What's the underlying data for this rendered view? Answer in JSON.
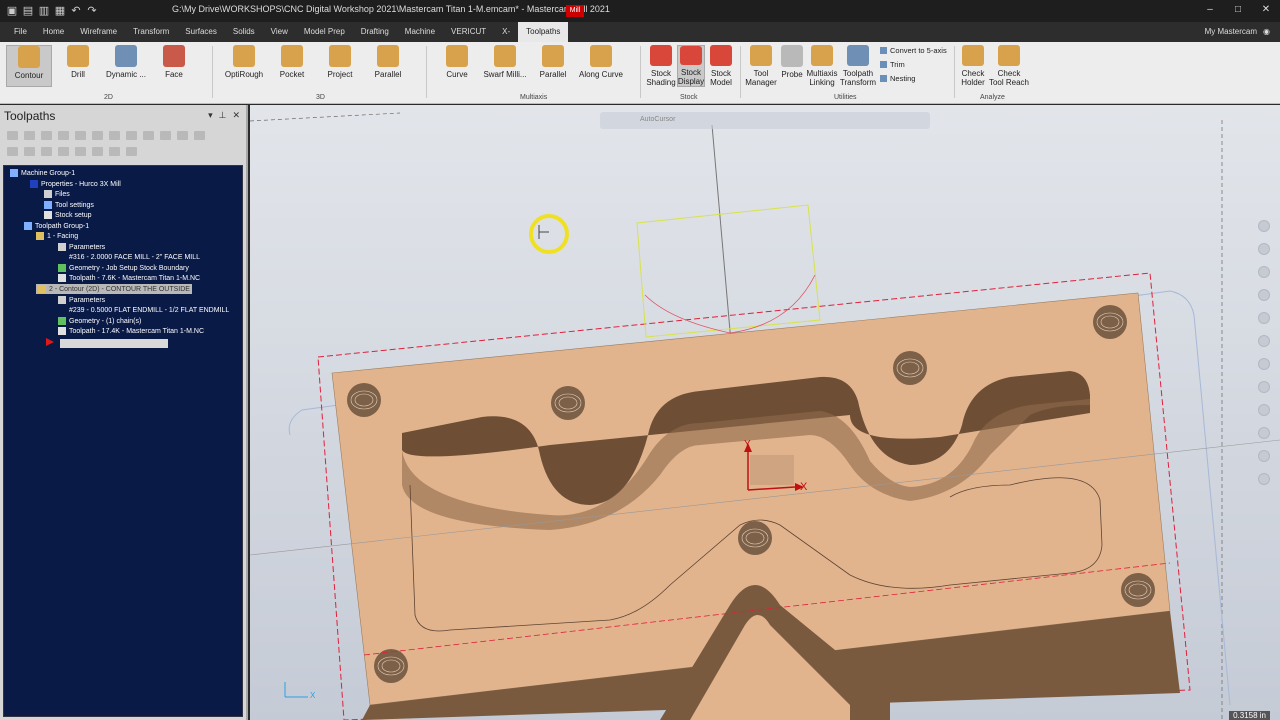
{
  "titlebar": {
    "title": "G:\\My Drive\\WORKSHOPS\\CNC Digital Workshop 2021\\Mastercam Titan 1-M.emcam* - Mastercam Mill 2021",
    "badge": "Mill",
    "controls": [
      "–",
      "□",
      "✕"
    ]
  },
  "menu": {
    "items": [
      "File",
      "Home",
      "Wireframe",
      "Transform",
      "Surfaces",
      "Solids",
      "View",
      "Model Prep",
      "Drafting",
      "Machine",
      "VERICUT",
      "X-",
      "Toolpaths"
    ],
    "active_index": 12,
    "right": "My Mastercam"
  },
  "ribbon": {
    "buttons_2d": [
      "Contour",
      "Drill",
      "Dynamic ...",
      "Face"
    ],
    "buttons_3d": [
      "OptiRough",
      "Pocket",
      "Project",
      "Parallel"
    ],
    "buttons_multiaxis": [
      "Curve",
      "Swarf Milli...",
      "Parallel",
      "Along Curve"
    ],
    "buttons_stock": [
      {
        "l1": "Stock",
        "l2": "Shading"
      },
      {
        "l1": "Stock",
        "l2": "Display"
      },
      {
        "l1": "Stock",
        "l2": "Model"
      }
    ],
    "buttons_utilities": [
      {
        "l1": "Tool",
        "l2": "Manager"
      },
      {
        "l1": "Probe",
        "l2": ""
      },
      {
        "l1": "Multiaxis",
        "l2": "Linking"
      },
      {
        "l1": "Toolpath",
        "l2": "Transform"
      }
    ],
    "small_utilities": [
      "Convert to 5-axis",
      "Trim",
      "Nesting"
    ],
    "buttons_analyze": [
      {
        "l1": "Check",
        "l2": "Holder"
      },
      {
        "l1": "Check",
        "l2": "Tool Reach"
      }
    ],
    "groups": [
      "2D",
      "3D",
      "Multiaxis",
      "Stock",
      "Utilities",
      "Analyze"
    ],
    "colors": {
      "stock_red": "#d9463a",
      "icon_gold": "#d8a24c",
      "icon_blue": "#6f8fb5"
    }
  },
  "panel": {
    "title": "Toolpaths",
    "tree": [
      "Machine Group-1",
      "Properties - Hurco 3X Mill",
      "Files",
      "Tool settings",
      "Stock setup",
      "Toolpath Group-1",
      "1 - Facing",
      "Parameters",
      "#316 - 2.0000 FACE MILL - 2\" FACE MILL",
      "Geometry - Job Setup Stock Boundary",
      "Toolpath - 7.6K - Mastercam Titan 1-M.NC",
      "2 - Contour (2D) - CONTOUR THE OUTSIDE",
      "Parameters",
      "#239 - 0.5000 FLAT ENDMILL - 1/2 FLAT ENDMILL",
      "Geometry - (1) chain(s)",
      "Toolpath - 17.4K - Mastercam Titan 1-M.NC"
    ]
  },
  "viewport": {
    "autocursor": "AutoCursor",
    "axis_x": "X",
    "axis_y": "Y",
    "scale": "0.3158 in",
    "colors": {
      "part_top": "#e2b48e",
      "wall": "#7a5a3e",
      "stock_boundary": "#e0203a",
      "tool_box": "#d8e24a",
      "cursor_ring": "#f0e024"
    }
  }
}
